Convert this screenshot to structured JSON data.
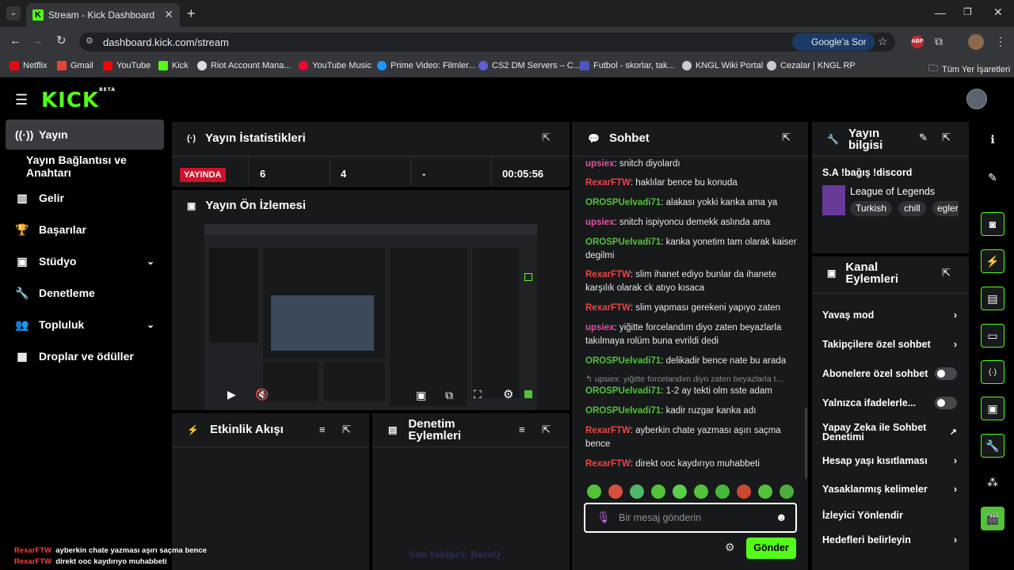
{
  "browser": {
    "tab_title": "Stream - Kick Dashboard",
    "url": "dashboard.kick.com/stream",
    "google_btn": "Google'a Sor",
    "bookmarks": [
      "Netflix",
      "Gmail",
      "YouTube",
      "Kick",
      "Riot Account Mana...",
      "YouTube Music",
      "Prime Video: Filmler...",
      "CS2 DM Servers – C...",
      "Futbol - skorlar, tak...",
      "KNGL Wiki Portal",
      "Cezalar | KNGL RP"
    ],
    "all_bookmarks": "Tüm Yer İşaretleri"
  },
  "kick": {
    "logo": "KICK",
    "beta": "BETA"
  },
  "nav": {
    "items": [
      "Yayın",
      "Yayın Bağlantısı ve Anahtarı",
      "Gelir",
      "Başarılar",
      "Stüdyo",
      "Denetleme",
      "Topluluk",
      "Droplar ve ödüller"
    ]
  },
  "stats": {
    "title": "Yayın İstatistikleri",
    "live": "YAYINDA",
    "v1": "6",
    "v2": "4",
    "v3": "-",
    "time": "00:05:56"
  },
  "preview": {
    "title": "Yayın Ön İzlemesi"
  },
  "activity": {
    "title": "Etkinlik Akışı"
  },
  "moderation": {
    "title": "Denetim Eylemleri"
  },
  "chat": {
    "title": "Sohbet",
    "messages": [
      {
        "user": "upsiex",
        "text": ": snitch diyolardı",
        "color": "#e84fa4"
      },
      {
        "user": "RexarFTW",
        "text": ": haklılar bence bu konuda",
        "color": "#ef4343"
      },
      {
        "user": "OROSPUelvadi71",
        "text": ": alakası yokki kanka ama ya",
        "color": "#53c23a"
      },
      {
        "user": "upsiex",
        "text": ": snitch ispiyoncu demekk aslında ama",
        "color": "#e84fa4"
      },
      {
        "user": "OROSPUelvadi71",
        "text": ": kanka yonetim tam olarak kaiser degilmi",
        "color": "#53c23a"
      },
      {
        "user": "RexarFTW",
        "text": ": slim ihanet ediyo bunlar da ihanete karşılık olarak ck atıyo kısaca",
        "color": "#ef4343"
      },
      {
        "user": "RexarFTW",
        "text": ": slim yapması gerekeni yapıyo zaten",
        "color": "#ef4343"
      },
      {
        "user": "upsiex",
        "text": ": yiğitte forcelandım diyo zaten beyazlarla takılmaya rolüm buna evrildi dedi",
        "color": "#e84fa4"
      },
      {
        "user": "OROSPUelvadi71",
        "text": ": delikadir bence nate bu arada",
        "color": "#53c23a"
      },
      {
        "user": "OROSPUelvadi71",
        "text": ": 1-2 ay tekti olm sste adam",
        "color": "#53c23a"
      },
      {
        "user": "OROSPUelvadi71",
        "text": ": kadir ruzgar kanka adı",
        "color": "#53c23a"
      },
      {
        "user": "RexarFTW",
        "text": ": ayberkin chate yazması aşırı saçma bence",
        "color": "#ef4343"
      },
      {
        "user": "RexarFTW",
        "text": ": direkt ooc kaydırıyo muhabbeti",
        "color": "#ef4343"
      }
    ],
    "reply": "upsiex: yiğitte forcelandım diyo zaten beyazlarla t...",
    "placeholder": "Bir mesaj gönderin",
    "send": "Gönder"
  },
  "info": {
    "title": "Yayın bilgisi",
    "stream_title": "S.A !bağış !discord",
    "category": "League of Legends",
    "tags": [
      "Turkish",
      "chill",
      "egler"
    ]
  },
  "channel": {
    "title": "Kanal Eylemleri",
    "items": [
      "Yavaş mod",
      "Takipçilere özel sohbet",
      "Abonelere özel sohbet",
      "Yalnızca ifadelerle...",
      "Yapay Zeka ile Sohbet Denetimi",
      "Hesap yaşı kısıtlaması",
      "Yasaklanmış kelimeler",
      "İzleyici Yönlendir",
      "Hedefleri belirleyin"
    ]
  },
  "overlay": {
    "line1_user": "RexarFTW",
    "line1_text": "ayberkin chate yazması aşırı saçma bence",
    "line2_user": "RexarFTW",
    "line2_text": "direkt ooc kaydırıyo muhabbeti",
    "follower": "Son takipçi: BarsQ"
  }
}
